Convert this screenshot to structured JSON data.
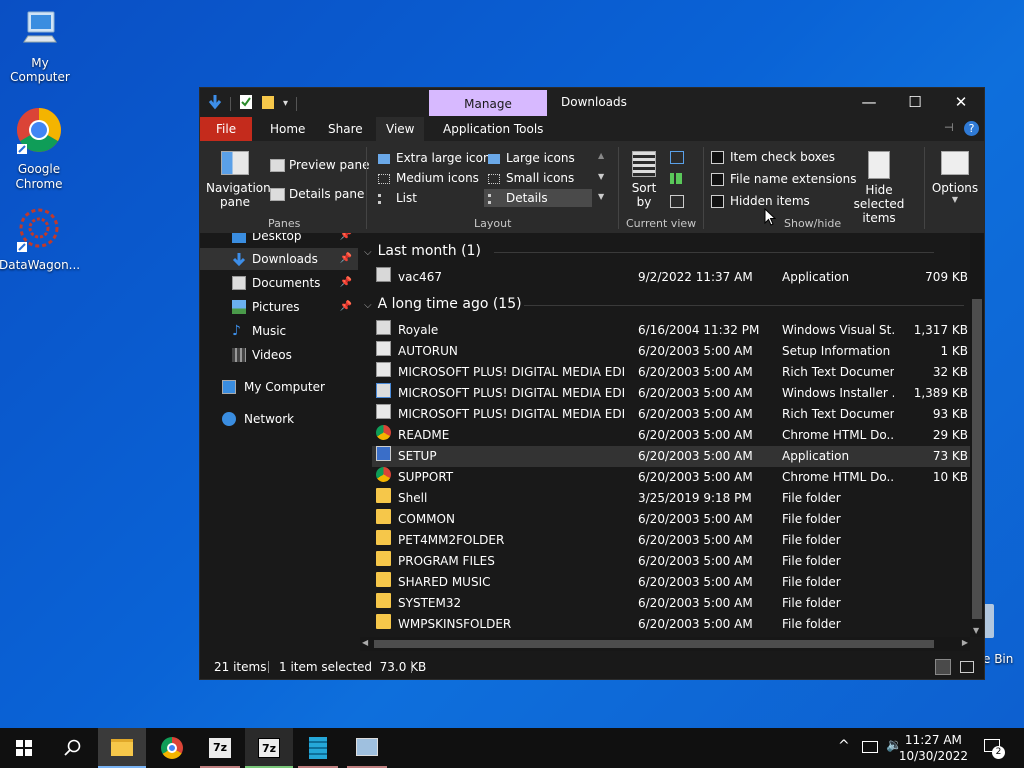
{
  "desktop": {
    "icons": [
      {
        "label": "My Computer",
        "icon": "computer-icon"
      },
      {
        "label": "Google Chrome",
        "icon": "chrome-icon"
      },
      {
        "label": "DataWagon...",
        "icon": "datawagon-icon"
      }
    ],
    "recycle_bin_label": "e Bin"
  },
  "window": {
    "title": "Downloads",
    "context_tab": "Manage",
    "tabs": [
      "File",
      "Home",
      "Share",
      "View",
      "Application Tools"
    ],
    "active_tab": "View"
  },
  "ribbon": {
    "panes": {
      "navigation_pane": "Navigation pane",
      "preview_pane": "Preview pane",
      "details_pane": "Details pane",
      "label": "Panes"
    },
    "layout": {
      "items": [
        "Extra large icons",
        "Large icons",
        "Medium icons",
        "Small icons",
        "List",
        "Details"
      ],
      "selected": "Details",
      "label": "Layout"
    },
    "current_view": {
      "sort_by": "Sort by",
      "label": "Current view"
    },
    "show_hide": {
      "item_check_boxes": "Item check boxes",
      "file_name_extensions": "File name extensions",
      "hidden_items": "Hidden items",
      "hide_selected_items": "Hide selected items",
      "label": "Show/hide"
    },
    "options": "Options"
  },
  "navigation": {
    "items": [
      {
        "label": "Desktop",
        "pinned": true
      },
      {
        "label": "Downloads",
        "pinned": true,
        "selected": true
      },
      {
        "label": "Documents",
        "pinned": true
      },
      {
        "label": "Pictures",
        "pinned": true
      },
      {
        "label": "Music"
      },
      {
        "label": "Videos"
      },
      {
        "label": "My Computer"
      },
      {
        "label": "Network"
      }
    ]
  },
  "files": {
    "groups": [
      {
        "title": "Last month (1)",
        "rows": [
          {
            "name": "vac467",
            "date": "9/2/2022 11:37 AM",
            "type": "Application",
            "size": "709 KB",
            "icon": "app-icon"
          }
        ]
      },
      {
        "title": "A long time ago (15)",
        "rows": [
          {
            "name": "Royale",
            "date": "6/16/2004 11:32 PM",
            "type": "Windows Visual St...",
            "size": "1,317 KB",
            "icon": "theme-icon"
          },
          {
            "name": "AUTORUN",
            "date": "6/20/2003 5:00 AM",
            "type": "Setup Information",
            "size": "1 KB",
            "icon": "setup-info-icon"
          },
          {
            "name": "MICROSOFT PLUS! DIGITAL MEDIA EDITI...",
            "date": "6/20/2003 5:00 AM",
            "type": "Rich Text Document",
            "size": "32 KB",
            "icon": "rtf-icon"
          },
          {
            "name": "MICROSOFT PLUS! DIGITAL MEDIA EDITI...",
            "date": "6/20/2003 5:00 AM",
            "type": "Windows Installer ...",
            "size": "1,389 KB",
            "icon": "installer-icon"
          },
          {
            "name": "MICROSOFT PLUS! DIGITAL MEDIA EDITI...",
            "date": "6/20/2003 5:00 AM",
            "type": "Rich Text Document",
            "size": "93 KB",
            "icon": "rtf-icon"
          },
          {
            "name": "README",
            "date": "6/20/2003 5:00 AM",
            "type": "Chrome HTML Do...",
            "size": "29 KB",
            "icon": "chrome-icon"
          },
          {
            "name": "SETUP",
            "date": "6/20/2003 5:00 AM",
            "type": "Application",
            "size": "73 KB",
            "icon": "app-icon",
            "selected": true
          },
          {
            "name": "SUPPORT",
            "date": "6/20/2003 5:00 AM",
            "type": "Chrome HTML Do...",
            "size": "10 KB",
            "icon": "chrome-icon"
          },
          {
            "name": "Shell",
            "date": "3/25/2019 9:18 PM",
            "type": "File folder",
            "size": "",
            "icon": "folder-icon"
          },
          {
            "name": "COMMON",
            "date": "6/20/2003 5:00 AM",
            "type": "File folder",
            "size": "",
            "icon": "folder-icon"
          },
          {
            "name": "PET4MM2FOLDER",
            "date": "6/20/2003 5:00 AM",
            "type": "File folder",
            "size": "",
            "icon": "folder-icon"
          },
          {
            "name": "PROGRAM FILES",
            "date": "6/20/2003 5:00 AM",
            "type": "File folder",
            "size": "",
            "icon": "folder-icon"
          },
          {
            "name": "SHARED MUSIC",
            "date": "6/20/2003 5:00 AM",
            "type": "File folder",
            "size": "",
            "icon": "folder-icon"
          },
          {
            "name": "SYSTEM32",
            "date": "6/20/2003 5:00 AM",
            "type": "File folder",
            "size": "",
            "icon": "folder-icon"
          },
          {
            "name": "WMPSKINSFOLDER",
            "date": "6/20/2003 5:00 AM",
            "type": "File folder",
            "size": "",
            "icon": "folder-icon"
          }
        ]
      }
    ]
  },
  "status": {
    "item_count": "21 items",
    "selection": "1 item selected  73.0 KB"
  },
  "taskbar": {
    "time": "11:27 AM",
    "date": "10/30/2022",
    "notification_count": "2",
    "apps": [
      "start-icon",
      "search-icon",
      "file-explorer-icon",
      "chrome-icon",
      "7zip-icon",
      "7zip-icon",
      "building-icon",
      "network-app-icon"
    ]
  }
}
